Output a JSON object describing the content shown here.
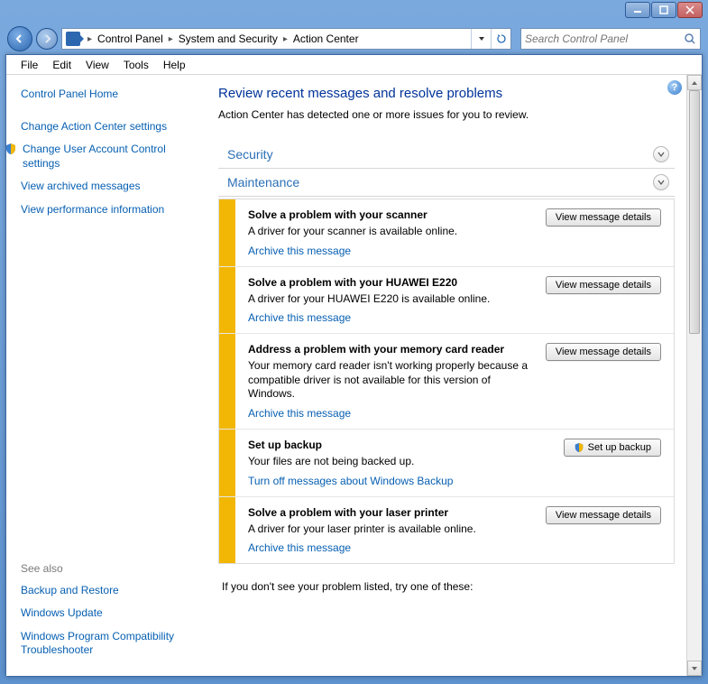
{
  "titlebar": {
    "minimize": "min",
    "maximize": "max",
    "close": "close"
  },
  "breadcrumbs": [
    "Control Panel",
    "System and Security",
    "Action Center"
  ],
  "search": {
    "placeholder": "Search Control Panel"
  },
  "menubar": [
    "File",
    "Edit",
    "View",
    "Tools",
    "Help"
  ],
  "sidebar": {
    "home": "Control Panel Home",
    "links": [
      {
        "label": "Change Action Center settings",
        "shield": false
      },
      {
        "label": "Change User Account Control settings",
        "shield": true
      },
      {
        "label": "View archived messages",
        "shield": false
      },
      {
        "label": "View performance information",
        "shield": false
      }
    ],
    "see_also_title": "See also",
    "see_also": [
      "Backup and Restore",
      "Windows Update",
      "Windows Program Compatibility Troubleshooter"
    ]
  },
  "main": {
    "title": "Review recent messages and resolve problems",
    "subtitle": "Action Center has detected one or more issues for you to review.",
    "security_label": "Security",
    "maintenance_label": "Maintenance",
    "messages": [
      {
        "title": "Solve a problem with your scanner",
        "desc": "A driver for your scanner is available online.",
        "link": "Archive this message",
        "button": "View message details",
        "shield": false
      },
      {
        "title": "Solve a problem with your HUAWEI E220",
        "desc": "A driver for your HUAWEI E220 is available online.",
        "link": "Archive this message",
        "button": "View message details",
        "shield": false
      },
      {
        "title": "Address a problem with your memory card reader",
        "desc": "Your memory card reader isn't working properly because a compatible driver is not available for this version of Windows.",
        "link": "Archive this message",
        "button": "View message details",
        "shield": false
      },
      {
        "title": "Set up backup",
        "desc": "Your files are not being backed up.",
        "link": "Turn off messages about Windows Backup",
        "button": "Set up backup",
        "shield": true
      },
      {
        "title": "Solve a problem with your laser printer",
        "desc": "A driver for your laser printer is available online.",
        "link": "Archive this message",
        "button": "View message details",
        "shield": false
      }
    ],
    "footer": "If you don't see your problem listed, try one of these:"
  }
}
